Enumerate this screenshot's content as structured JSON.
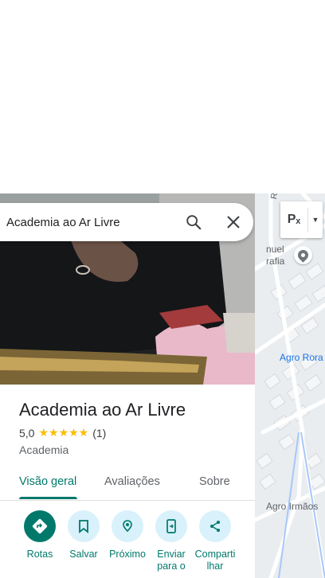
{
  "search": {
    "query": "Academia ao Ar Livre"
  },
  "map": {
    "layer_button_label": "Pₓ",
    "street_label_top": "Rui B",
    "place_label_line1": "nuel",
    "place_label_line2": "rafia",
    "area_label": "Agro Rora",
    "bottom_label": "Agro Irmãos"
  },
  "place": {
    "name": "Academia ao Ar Livre",
    "rating": "5,0",
    "stars": "★★★★★",
    "review_count": "(1)",
    "category": "Academia"
  },
  "tabs": [
    {
      "label": "Visão geral",
      "active": true
    },
    {
      "label": "Avaliações",
      "active": false
    },
    {
      "label": "Sobre",
      "active": false
    }
  ],
  "actions": [
    {
      "label": "Rotas",
      "icon": "directions-icon"
    },
    {
      "label": "Salvar",
      "icon": "bookmark-icon"
    },
    {
      "label": "Próximo",
      "icon": "nearby-icon"
    },
    {
      "label": "Enviar para o",
      "icon": "send-to-phone-icon"
    },
    {
      "label": "Comparti lhar",
      "icon": "share-icon"
    }
  ],
  "colors": {
    "accent": "#00796b",
    "action_bg": "#d8f1fb",
    "star": "#fbbc04",
    "map_area_text": "#1a73e8"
  }
}
